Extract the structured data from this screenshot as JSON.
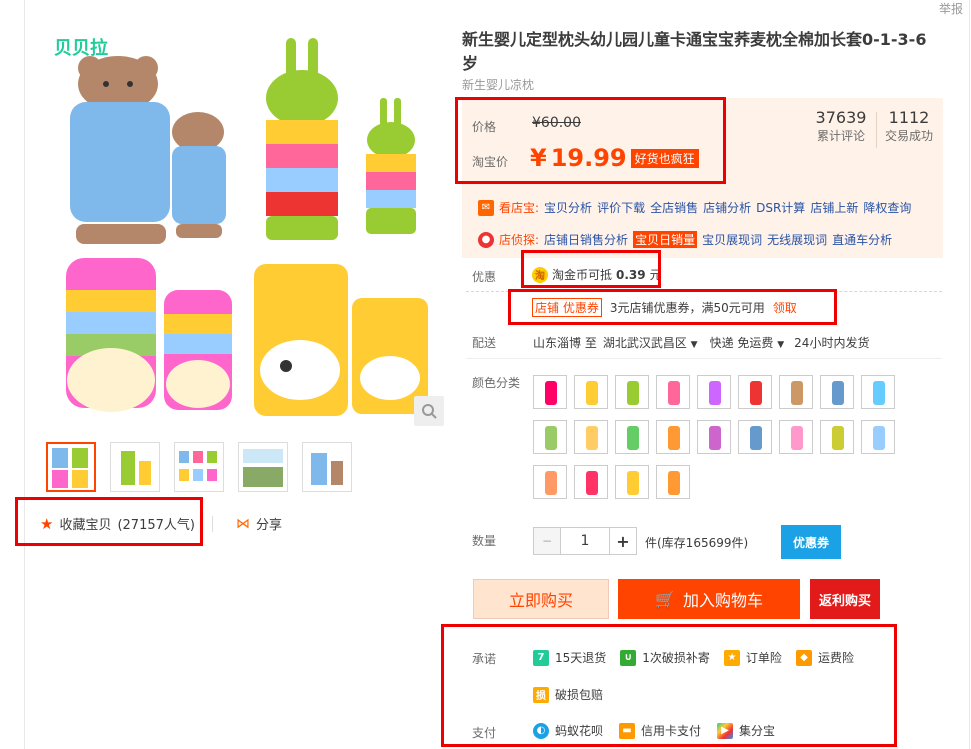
{
  "report_label": "举报",
  "gallery": {
    "brand_logo": "贝贝拉",
    "thumbnail_count": 5,
    "favorite_label": "收藏宝贝",
    "favorite_count": "(27157人气)",
    "share_label": "分享"
  },
  "product": {
    "title": "新生婴儿定型枕头幼儿园儿童卡通宝宝荞麦枕全棉加长套0-1-3-6岁",
    "subtitle": "新生婴儿凉枕"
  },
  "price": {
    "price_label": "价格",
    "original_price": "¥60.00",
    "taobao_label": "淘宝价",
    "currency": "¥",
    "current_price": "19.99",
    "promo_tag": "好货也疯狂",
    "reviews_count": "37639",
    "reviews_label": "累计评论",
    "deals_count": "1112",
    "deals_label": "交易成功"
  },
  "shop_tools": {
    "kandian_label": "看店宝:",
    "kandian_links": [
      "宝贝分析",
      "评价下载",
      "全店销售",
      "店铺分析",
      "DSR计算",
      "店铺上新",
      "降权查询"
    ],
    "dianzhen_label": "店侦探:",
    "dianzhen_links": [
      "店铺日销售分析",
      "宝贝日销量",
      "宝贝展现词",
      "无线展现词",
      "直通车分析"
    ]
  },
  "discount": {
    "label": "优惠",
    "coin_text": "淘金币可抵",
    "coin_value": "0.39",
    "coin_unit": "元",
    "coupon_tag": "店铺 优惠券",
    "coupon_desc": "3元店铺优惠券，满50元可用",
    "coupon_claim": "领取"
  },
  "shipping": {
    "label": "配送",
    "from": "山东淄博 至",
    "to": "湖北武汉武昌区",
    "method": "快递 免运费",
    "time": "24小时内发货"
  },
  "color": {
    "label": "颜色分类",
    "swatches": [
      "#f06",
      "#fc3",
      "#9c3",
      "#f69",
      "#c6f",
      "#e33",
      "#c96",
      "#69c",
      "#6cf",
      "#9c6",
      "#fc6",
      "#6c6",
      "#f93",
      "#c6c",
      "#69c",
      "#f9c",
      "#cc3",
      "#9cf",
      "#f96",
      "#f36",
      "#fc3",
      "#f93"
    ]
  },
  "quantity": {
    "label": "数量",
    "value": "1",
    "unit_stock": "件(库存165699件)",
    "coupon_btn": "优惠券"
  },
  "actions": {
    "buy_now": "立即购买",
    "add_cart": "加入购物车",
    "rebate": "返利购买"
  },
  "promise": {
    "label": "承诺",
    "items": [
      "15天退货",
      "1次破损补寄",
      "订单险",
      "运费险",
      "破损包赔"
    ]
  },
  "payment": {
    "label": "支付",
    "items": [
      "蚂蚁花呗",
      "信用卡支付",
      "集分宝"
    ]
  },
  "colors": {
    "accent": "#ff4400",
    "highlight_box": "#ee0000",
    "link": "#2953a6",
    "price_bg": "#fff2e8",
    "coupon_blue": "#1aa1e6"
  }
}
